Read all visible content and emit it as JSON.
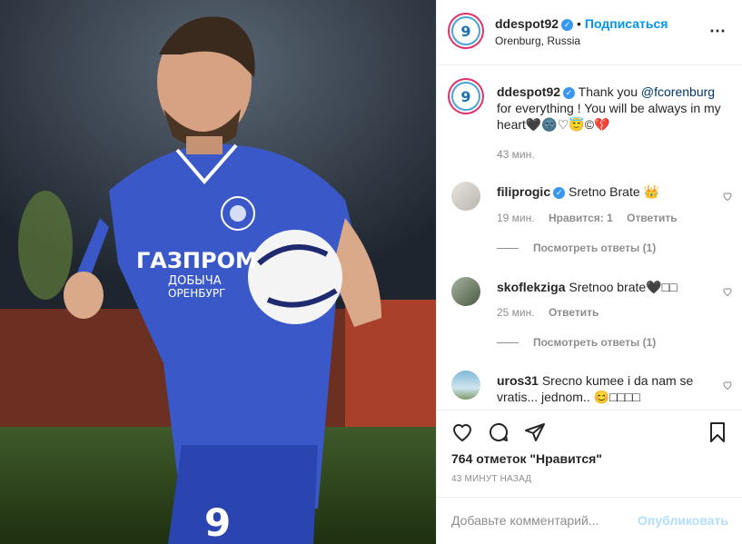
{
  "post": {
    "username": "ddespot92",
    "follow_label": "Подписаться",
    "location": "Orenburg, Russia",
    "avatar_text": "9",
    "caption_prefix": "Thank you ",
    "caption_mention": "@fcorenburg",
    "caption_suffix": " for everything ! You will be always in my heart🖤🌚♡😇©💔",
    "caption_time": "43 мин.",
    "likes": "764 отметок \"Нравится\"",
    "posted_ago": "43 МИНУТ НАЗАД",
    "add_comment_placeholder": "Добавьте комментарий...",
    "publish_label": "Опубликовать",
    "photo_sponsor_line1": "ГАЗПРОМ",
    "photo_sponsor_line2": "ДОБЫЧА",
    "photo_sponsor_line3": "ОРЕНБУРГ",
    "photo_jersey_number": "9"
  },
  "comments": [
    {
      "username": "filiprogic",
      "verified": true,
      "text": "Sretno Brate 👑",
      "time": "19 мин.",
      "likes_label": "Нравится: 1",
      "reply_label": "Ответить",
      "view_replies": "Посмотреть ответы (1)"
    },
    {
      "username": "skoflekziga",
      "verified": false,
      "text": "Sretnoo brate🖤□□",
      "time": "25 мин.",
      "reply_label": "Ответить",
      "view_replies": "Посмотреть ответы (1)"
    },
    {
      "username": "uros31",
      "verified": false,
      "text": "Srecno kumee i da nam se vratis... jednom.. 😊□□□□"
    }
  ],
  "icons": [
    "more-options-icon",
    "verified-icon",
    "heart-icon",
    "comment-icon",
    "share-icon",
    "bookmark-icon"
  ],
  "colors": {
    "link": "#0095f6",
    "mention": "#00376b",
    "verified": "#3897f0",
    "muted": "#8e8e8e"
  }
}
